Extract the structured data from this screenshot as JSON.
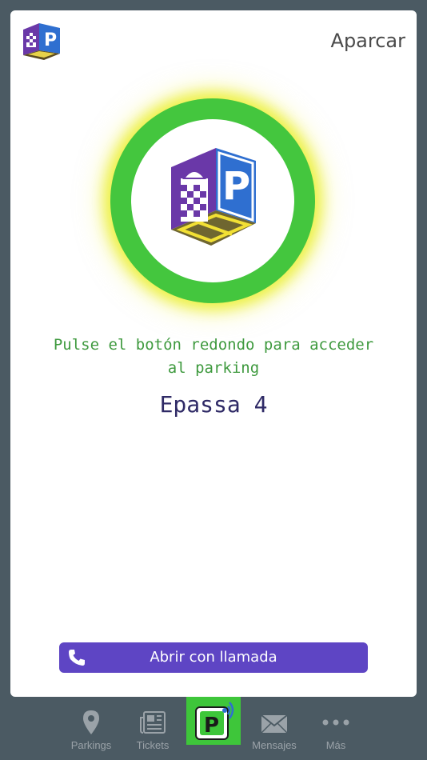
{
  "header": {
    "title": "Aparcar",
    "logo_icon": "parking-cube-logo"
  },
  "access": {
    "button_icon": "parking-cube-logo"
  },
  "instruction": "Pulse el botón redondo para acceder al parking",
  "device_name": "Epassa 4",
  "call_button": {
    "label": "Abrir con llamada",
    "icon": "phone-icon"
  },
  "tabbar": {
    "tabs": [
      {
        "label": "Parkings",
        "icon": "map-pin-icon"
      },
      {
        "label": "Tickets",
        "icon": "newspaper-icon"
      },
      {
        "label": "",
        "icon": "parking-nfc-icon"
      },
      {
        "label": "Mensajes",
        "icon": "envelope-icon"
      },
      {
        "label": "Más",
        "icon": "more-dots-icon"
      }
    ]
  },
  "colors": {
    "background": "#4b5a63",
    "ring": "#44c63e",
    "instruction_text": "#3f9a3f",
    "device_text": "#2f2a66",
    "call_button": "#5e45c4",
    "tab_inactive": "#9aa2a8"
  }
}
